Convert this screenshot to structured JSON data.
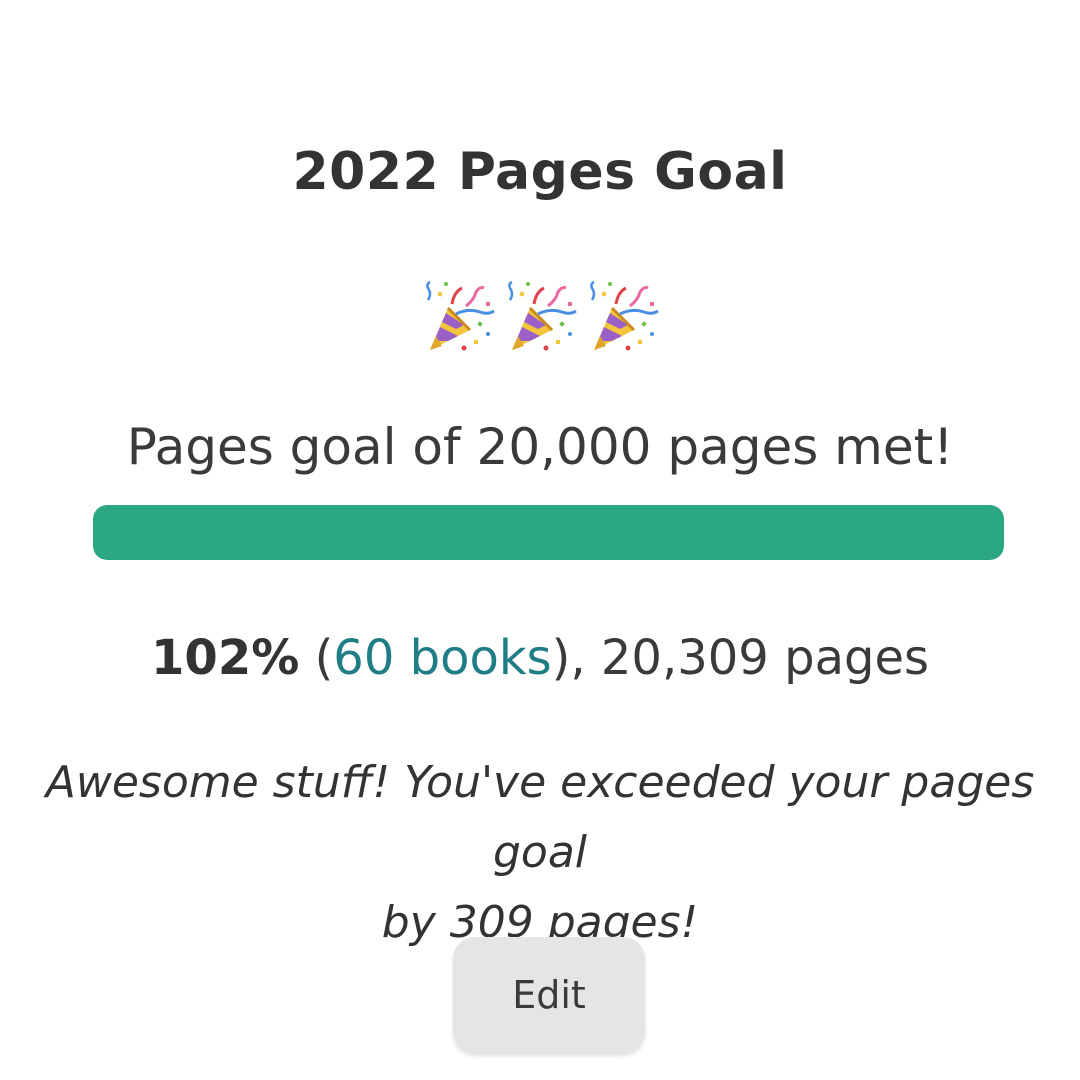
{
  "goal": {
    "title": "2022 Pages Goal",
    "celebration_icons": [
      "party-popper-icon",
      "party-popper-icon",
      "party-popper-icon"
    ],
    "status_text": "Pages goal of 20,000 pages met!",
    "progress_fraction": 1.0,
    "progress_color": "#2ba882"
  },
  "stats": {
    "percent": "102%",
    "open_paren": " (",
    "books_link": "60 books",
    "close_and_pages": "), 20,309 pages",
    "link_color": "#1e7d85"
  },
  "message": {
    "line1": "Awesome stuff! You've exceeded your pages goal",
    "line2": "by 309 pages!"
  },
  "actions": {
    "edit_label": "Edit"
  }
}
